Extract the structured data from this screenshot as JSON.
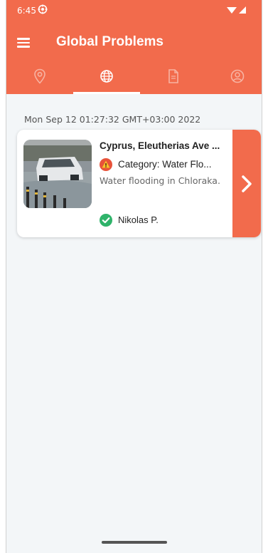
{
  "status_bar": {
    "time": "6:45"
  },
  "toolbar": {
    "title": "Global Problems"
  },
  "tabs": [
    {
      "icon": "location-pin-icon",
      "active": false
    },
    {
      "icon": "globe-icon",
      "active": true
    },
    {
      "icon": "document-icon",
      "active": false
    },
    {
      "icon": "profile-icon",
      "active": false
    }
  ],
  "feed": {
    "timestamp": "Mon Sep 12 01:27:32 GMT+03:00 2022",
    "items": [
      {
        "title": "Cyprus, Eleutherias Ave ...",
        "category": "Category: Water Flo...",
        "description": "Water flooding in Chloraka.",
        "author": "Nikolas P."
      }
    ]
  },
  "colors": {
    "accent": "#f26b4c",
    "background": "#f3f6f8",
    "warning": "#e8533a",
    "success": "#2fb36a"
  }
}
